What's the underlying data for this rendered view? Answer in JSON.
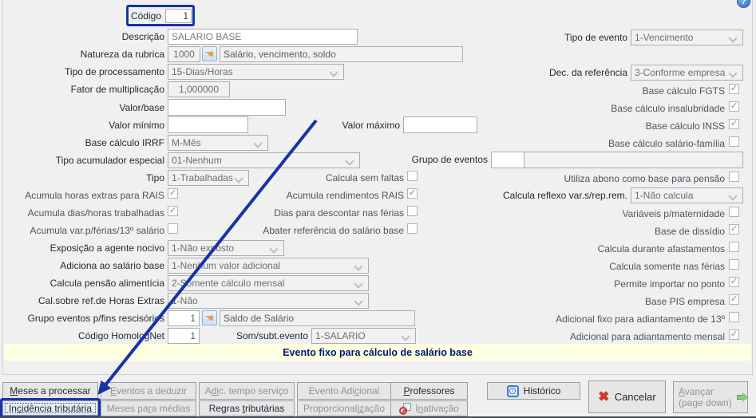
{
  "colors": {
    "window_bg": "#f0f0f0",
    "accent_navy": "#1734a4",
    "banner_bg": "#ffffe1",
    "banner_text": "#001a6e",
    "disabled_text": "#6d6d6d",
    "check_color": "#a3aeab",
    "cancel_red": "#d13a28",
    "forward_green": "#8dc87e",
    "history_blue": "#3a7bd5"
  },
  "icons": {
    "help_q": "?",
    "hand": "☚",
    "cancel_x": "✖"
  },
  "fields": {
    "codigo": {
      "label": "Código",
      "value": "1"
    },
    "descricao": {
      "label": "Descrição",
      "value": "SALARIO BASE"
    },
    "tipo_evento": {
      "label": "Tipo de evento",
      "value": "1-Vencimento"
    },
    "natureza": {
      "label": "Natureza da rubrica",
      "code": "1000",
      "desc": "Salário, vencimento, soldo"
    },
    "tipo_processamento": {
      "label": "Tipo de processamento",
      "value": "15-Dias/Horas"
    },
    "dec_referencia": {
      "label": "Dec. da referência",
      "value": "3-Conforme empresa"
    },
    "fator_multiplicacao": {
      "label": "Fator de multiplicação",
      "value": "1,000000"
    },
    "valor_base": {
      "label": "Valor/base",
      "value": ""
    },
    "valor_minimo": {
      "label": "Valor mínimo",
      "value": ""
    },
    "valor_maximo": {
      "label": "Valor máximo",
      "value": ""
    },
    "base_calculo_irrf": {
      "label": "Base cálculo IRRF",
      "value": "M-Mês"
    },
    "tipo_acumulador_especial": {
      "label": "Tipo acumulador especial",
      "value": "01-Nenhum"
    },
    "grupo_de_eventos": {
      "label": "Grupo de eventos",
      "code": "",
      "desc": ""
    },
    "tipo": {
      "label": "Tipo",
      "value": "1-Trabalhadas"
    },
    "calcula_reflexo": {
      "label": "Calcula reflexo var.s/rep.rem.",
      "value": "1-Não calcula"
    },
    "exposicao_agente_nocivo": {
      "label": "Exposição a agente nocivo",
      "value": "1-Não exposto"
    },
    "adiciona_ao_salario_base": {
      "label": "Adiciona ao salário base",
      "value": "1-Nenhum valor adicional"
    },
    "calcula_pensao_alimenticia": {
      "label": "Calcula pensão alimentícia",
      "value": "2-Somente cálculo mensal"
    },
    "cal_sobre_ref_horas_extras": {
      "label": "Cal.sobre ref.de Horas Extras",
      "value": "1-Não"
    },
    "grupo_eventos_rescisorios": {
      "label": "Grupo eventos p/fins rescisórios",
      "code": "1",
      "desc": "Saldo de Salário"
    },
    "codigo_homolognet": {
      "label": "Código HomologNet",
      "value": "1"
    },
    "som_subt_evento": {
      "label": "Som/subt.evento",
      "value": "1-SALARIO"
    }
  },
  "checkboxes": {
    "base_calculo_fgts": {
      "label": "Base cálculo FGTS",
      "checked": true,
      "mark": "✓"
    },
    "base_calculo_insalubridade": {
      "label": "Base cálculo insalubridade",
      "checked": true,
      "mark": "✓"
    },
    "base_calculo_inss": {
      "label": "Base cálculo INSS",
      "checked": true,
      "mark": "✓"
    },
    "base_calculo_salario_familia": {
      "label": "Base cálculo salário-família",
      "checked": false,
      "mark": ""
    },
    "calcula_sem_faltas": {
      "label": "Calcula sem faltas",
      "checked": false,
      "mark": ""
    },
    "utiliza_abono_pensao": {
      "label": "Utiliza abono como base para pensão",
      "checked": false,
      "mark": ""
    },
    "acumula_horas_extras_rais": {
      "label": "Acumula horas extras para RAIS",
      "checked": true,
      "mark": "✓"
    },
    "acumula_rendimentos_rais": {
      "label": "Acumula rendimentos RAIS",
      "checked": true,
      "mark": "✓"
    },
    "acumula_dias_horas_trabalhadas": {
      "label": "Acumula dias/horas trabalhadas",
      "checked": true,
      "mark": "✓"
    },
    "dias_descontar_ferias": {
      "label": "Dias para descontar nas férias",
      "checked": false,
      "mark": ""
    },
    "variaveis_maternidade": {
      "label": "Variáveis p/maternidade",
      "checked": false,
      "mark": ""
    },
    "acumula_var_ferias_13": {
      "label": "Acumula var.p/férias/13º salário",
      "checked": false,
      "mark": ""
    },
    "abater_referencia_salario_base": {
      "label": "Abater referência do salário base",
      "checked": false,
      "mark": ""
    },
    "base_de_dissidio": {
      "label": "Base de dissídio",
      "checked": true,
      "mark": "✓"
    },
    "calcula_durante_afastamentos": {
      "label": "Calcula durante afastamentos",
      "checked": false,
      "mark": ""
    },
    "calcula_somente_ferias": {
      "label": "Calcula somente nas férias",
      "checked": false,
      "mark": ""
    },
    "permite_importar_ponto": {
      "label": "Permite importar no ponto",
      "checked": true,
      "mark": "✓"
    },
    "base_pis_empresa": {
      "label": "Base PIS empresa",
      "checked": true,
      "mark": "✓"
    },
    "adicional_fixo_adiantamento_13": {
      "label": "Adicional fixo para adiantamento de 13º",
      "checked": false,
      "mark": ""
    },
    "adicional_adiantamento_mensal": {
      "label": "Adicional para adiantamento mensal",
      "checked": true,
      "mark": "✓"
    }
  },
  "banner": {
    "text": "Evento fixo para cálculo de salário base"
  },
  "buttons": {
    "meses_a_processar": {
      "pre": "",
      "accel": "M",
      "post": "eses a processar"
    },
    "eventos_a_deduzir": {
      "pre": "",
      "accel": "E",
      "post": "ventos a deduzir"
    },
    "adic_tempo_servico": {
      "pre": "A",
      "accel": "di",
      "post": "c. tempo serviço"
    },
    "evento_adicional": {
      "pre": "Evento Adi",
      "accel": "c",
      "post": "ional"
    },
    "professores": {
      "pre": "",
      "accel": "P",
      "post": "rofessores"
    },
    "historico": {
      "label": "Histórico"
    },
    "cancelar": {
      "label": "Cancelar"
    },
    "avancar": {
      "pre": "",
      "accel": "A",
      "post": "vançar",
      "line2": "(page down)"
    },
    "incidencia_tributaria": {
      "pre": "In",
      "accel": "c",
      "post": "idência tributária"
    },
    "meses_para_medias": {
      "pre": "Meses pa",
      "accel": "r",
      "post": "a médias"
    },
    "regras_tributarias": {
      "pre": "Regras ",
      "accel": "t",
      "post": "ributárias"
    },
    "proporcionalizacao": {
      "pre": "Proporcional",
      "accel": "iz",
      "post": "ação"
    },
    "inativacao": {
      "pre": "I",
      "accel": "n",
      "post": "ativação"
    }
  }
}
